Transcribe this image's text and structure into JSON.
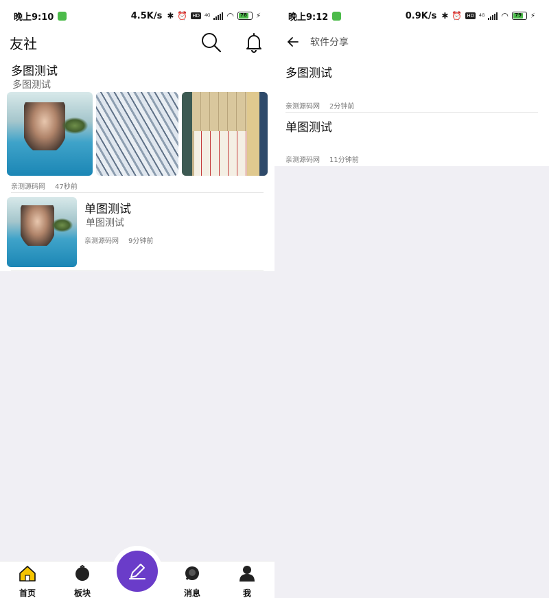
{
  "left": {
    "status": {
      "time": "晚上9:10",
      "speed": "4.5K/s",
      "network": "4G",
      "hd": "HD",
      "battery": "78"
    },
    "header": {
      "title": "友社"
    },
    "posts": [
      {
        "title": "多图测试",
        "subtitle": "多图测试",
        "author": "亲测源码网",
        "time": "47秒前"
      },
      {
        "title": "单图测试",
        "subtitle": "单图测试",
        "author": "亲测源码网",
        "time": "9分钟前"
      }
    ],
    "nav": {
      "home": "首页",
      "boards": "板块",
      "messages": "消息",
      "me": "我"
    }
  },
  "right": {
    "status": {
      "time": "晚上9:12",
      "speed": "0.9K/s",
      "network": "4G",
      "hd": "HD",
      "battery": "79"
    },
    "header": {
      "title": "软件分享"
    },
    "posts": [
      {
        "title": "多图测试",
        "author": "亲测源码网",
        "time": "2分钟前"
      },
      {
        "title": "单图测试",
        "author": "亲测源码网",
        "time": "11分钟前"
      }
    ]
  },
  "colors": {
    "accent": "#6a3cc9",
    "home_icon": "#f5c400",
    "status_green": "#4cbb4a"
  }
}
